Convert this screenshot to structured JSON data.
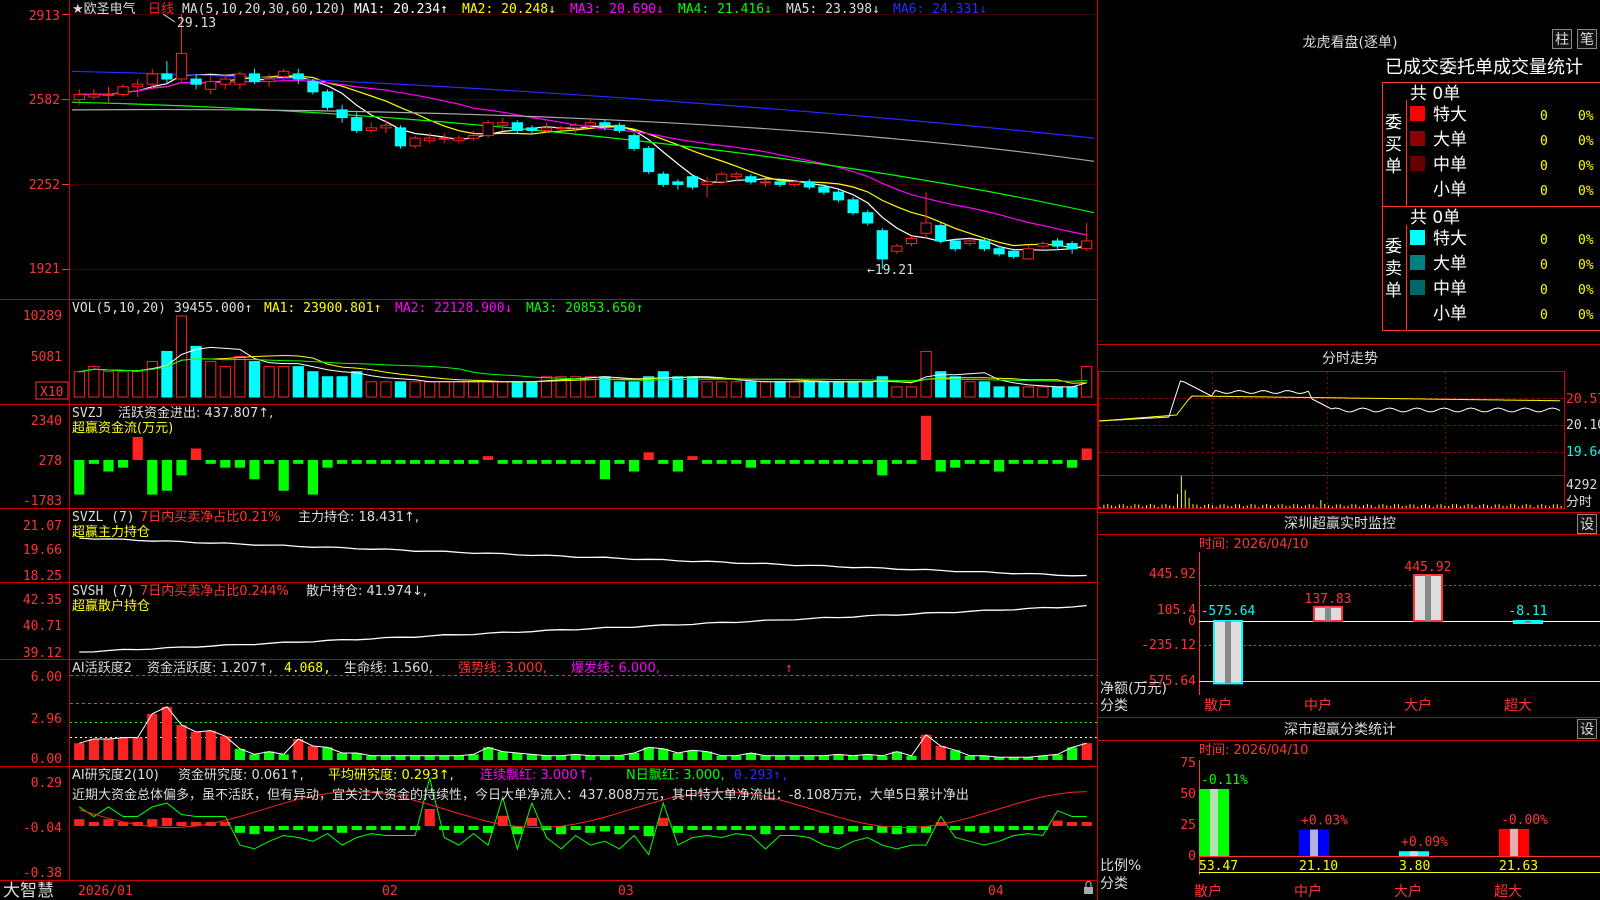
{
  "stock": {
    "name": "★欧圣电气",
    "period": "日线"
  },
  "colors": {
    "up": "#ff2222",
    "down": "#00ffff",
    "grid": "#8a0000",
    "white": "#ffffff",
    "yellow": "#ffff00",
    "magenta": "#ff00ff",
    "green": "#00ff00",
    "blue": "#2a2aff",
    "gray": "#aaaaaa",
    "axis": "#ff3333"
  },
  "price_panel": {
    "header": {
      "label": "MA(5,10,20,30,60,120)",
      "ma1": "MA1: 20.234↑",
      "ma2": "MA2: 20.248↓",
      "ma3": "MA3: 20.690↓",
      "ma4": "MA4: 21.416↓",
      "ma5": "MA5: 23.398↓",
      "ma6": "MA6: 24.331↓"
    },
    "y_ticks": [
      "2913",
      "2582",
      "2252",
      "1921"
    ],
    "high_label": "29.13",
    "low_label": "←19.21"
  },
  "vol_panel": {
    "header": {
      "label": "VOL(5,10,20)",
      "value": "39455.000↑",
      "ma1": "MA1: 23900.801↑",
      "ma2": "MA2: 22128.900↓",
      "ma3": "MA3: 20853.650↑"
    },
    "y_ticks": [
      "10289",
      "5081"
    ],
    "unit": "X10"
  },
  "svzj_panel": {
    "header": {
      "label": "SVZJ",
      "title": "活跃资金进出: 437.807↑,",
      "sub": "超赢资金流(万元)"
    },
    "y_ticks": [
      "2340",
      "278",
      "-1783"
    ]
  },
  "svzl_panel": {
    "header": {
      "label": "SVZL (7)",
      "pct": "7日内买卖净占比0.21%",
      "main": "主力持仓: 18.431↑,",
      "sub": "超赢主力持仓"
    },
    "y_ticks": [
      "21.07",
      "19.66",
      "18.25"
    ]
  },
  "svsh_panel": {
    "header": {
      "label": "SVSH (7)",
      "pct": "7日内买卖净占比0.244%",
      "main": "散户持仓: 41.974↓,",
      "sub": "超赢散户持仓"
    },
    "y_ticks": [
      "42.35",
      "40.71",
      "39.12"
    ]
  },
  "ai_active_panel": {
    "header": {
      "label": "AI活跃度2",
      "a": "资金活跃度: 1.207↑,",
      "b": "4.068,",
      "c": "生命线: 1.560,",
      "d": "强势线: 3.000,",
      "e": "爆发线: 6.000,",
      "f": "↑"
    },
    "y_ticks": [
      "6.00",
      "2.96",
      "0.00"
    ]
  },
  "ai_research_panel": {
    "header": {
      "label": "AI研究度2(10)",
      "a": "资金研究度: 0.061↑,",
      "b": "平均研究度: 0.293↑,",
      "c": "连续飘红: 3.000↑,",
      "d": "N日飘红: 3.000,",
      "e": "0.293↑,"
    },
    "comment": "近期大资金总体偏多，虽不活跃，但有异动，宜关注大资金的持续性，今日大单净流入：437.808万元，其中特大单净流出：-8.108万元，大单5日累计净出",
    "y_ticks": [
      "0.29",
      "-0.04",
      "-0.38"
    ]
  },
  "x_axis": {
    "labels": [
      "2026/01",
      "02",
      "03",
      "04"
    ]
  },
  "bottom_left": "大智慧",
  "lhb": {
    "title": "龙虎看盘(逐单)",
    "btn1": "柱",
    "btn2": "笔",
    "subtitle": "已成交委托单成交量统计",
    "buy": {
      "side": "委买单",
      "total": "共 0单",
      "rows": [
        {
          "label": "特大",
          "count": "0",
          "pct": "0%",
          "color": "#ff0000"
        },
        {
          "label": "大单",
          "count": "0",
          "pct": "0%",
          "color": "#8b0000"
        },
        {
          "label": "中单",
          "count": "0",
          "pct": "0%",
          "color": "#660000"
        },
        {
          "label": "小单",
          "count": "0",
          "pct": "0%",
          "color": ""
        }
      ]
    },
    "sell": {
      "side": "委卖单",
      "total": "共 0单",
      "rows": [
        {
          "label": "特大",
          "count": "0",
          "pct": "0%",
          "color": "#00ffff"
        },
        {
          "label": "大单",
          "count": "0",
          "pct": "0%",
          "color": "#008080"
        },
        {
          "label": "中单",
          "count": "0",
          "pct": "0%",
          "color": "#006666"
        },
        {
          "label": "小单",
          "count": "0",
          "pct": "0%",
          "color": ""
        }
      ]
    }
  },
  "intraday": {
    "title": "分时走势",
    "y_ticks": [
      "20.57",
      "20.10",
      "19.64"
    ],
    "vol_tick": "4292",
    "vol_unit": "分时"
  },
  "sz_monitor": {
    "title": "深圳超赢实时监控",
    "btn": "设",
    "time": "时间: 2026/04/10",
    "y_ticks": [
      "445.92",
      "105.4",
      "0",
      "-235.12",
      "-575.64"
    ],
    "y_label": "净额(万元)",
    "x_label": "分类",
    "categories": [
      "散户",
      "中户",
      "大户",
      "超大"
    ],
    "values": [
      -575.64,
      137.83,
      445.92,
      -8.11
    ],
    "value_labels": [
      "-575.64",
      "137.83",
      "445.92",
      "-8.11"
    ]
  },
  "sz_class": {
    "title": "深市超赢分类统计",
    "btn": "设",
    "time": "时间: 2026/04/10",
    "y_ticks": [
      "75",
      "50",
      "25",
      "0"
    ],
    "y_label": "比例%",
    "x_label": "分类",
    "categories": [
      "散户",
      "中户",
      "大户",
      "超大"
    ],
    "values": [
      53.47,
      21.1,
      3.8,
      21.63
    ],
    "value_labels": [
      "53.47",
      "21.10",
      "3.80",
      "21.63"
    ],
    "changes": [
      "-0.11%",
      "+0.03%",
      "+0.09%",
      "-0.00%"
    ],
    "bar_colors": [
      "#00ff00",
      "#0000ff",
      "#00ffff",
      "#ff0000"
    ]
  },
  "candles": [
    [
      25.8,
      26.0,
      25.6,
      26.2
    ],
    [
      25.9,
      26.0,
      25.8,
      26.2
    ],
    [
      26.0,
      26.0,
      25.7,
      26.3
    ],
    [
      26.0,
      26.3,
      25.9,
      26.4
    ],
    [
      26.3,
      26.4,
      25.9,
      26.6
    ],
    [
      26.4,
      26.8,
      26.2,
      27.0
    ],
    [
      26.8,
      26.6,
      26.4,
      27.3
    ],
    [
      26.6,
      27.6,
      26.5,
      29.13
    ],
    [
      26.6,
      26.4,
      26.2,
      26.8
    ],
    [
      26.2,
      26.5,
      26.0,
      26.7
    ],
    [
      26.4,
      26.6,
      26.2,
      26.8
    ],
    [
      26.4,
      26.8,
      26.2,
      26.9
    ],
    [
      26.8,
      26.5,
      26.4,
      27.0
    ],
    [
      26.5,
      26.6,
      26.3,
      26.8
    ],
    [
      26.7,
      26.9,
      26.5,
      27.0
    ],
    [
      26.8,
      26.6,
      26.4,
      27.0
    ],
    [
      26.5,
      26.1,
      26.0,
      26.6
    ],
    [
      26.1,
      25.5,
      25.4,
      26.2
    ],
    [
      25.4,
      25.1,
      24.9,
      25.6
    ],
    [
      25.1,
      24.6,
      24.5,
      25.3
    ],
    [
      24.6,
      24.7,
      24.5,
      24.9
    ],
    [
      24.7,
      24.8,
      24.5,
      25.0
    ],
    [
      24.7,
      24.0,
      23.9,
      24.8
    ],
    [
      24.0,
      24.3,
      23.9,
      24.4
    ],
    [
      24.2,
      24.3,
      24.1,
      24.5
    ],
    [
      24.3,
      24.3,
      24.1,
      24.5
    ],
    [
      24.2,
      24.3,
      24.1,
      24.4
    ],
    [
      24.3,
      24.4,
      24.2,
      24.6
    ],
    [
      24.4,
      24.9,
      24.3,
      25.0
    ],
    [
      24.8,
      24.9,
      24.6,
      25.1
    ],
    [
      24.9,
      24.6,
      24.5,
      25.0
    ],
    [
      24.7,
      24.6,
      24.5,
      24.8
    ],
    [
      24.6,
      24.7,
      24.5,
      24.9
    ],
    [
      24.7,
      24.7,
      24.6,
      24.8
    ],
    [
      24.7,
      24.8,
      24.5,
      24.9
    ],
    [
      24.8,
      24.9,
      24.7,
      25.0
    ],
    [
      24.9,
      24.8,
      24.6,
      25.0
    ],
    [
      24.8,
      24.6,
      24.5,
      24.9
    ],
    [
      24.4,
      23.9,
      23.8,
      24.5
    ],
    [
      23.9,
      23.0,
      22.9,
      24.0
    ],
    [
      22.9,
      22.5,
      22.4,
      23.0
    ],
    [
      22.6,
      22.5,
      22.3,
      22.7
    ],
    [
      22.8,
      22.4,
      22.3,
      22.9
    ],
    [
      22.5,
      22.6,
      22.0,
      22.8
    ],
    [
      22.6,
      22.9,
      22.5,
      23.0
    ],
    [
      22.8,
      22.9,
      22.6,
      23.0
    ],
    [
      22.8,
      22.6,
      22.5,
      22.9
    ],
    [
      22.6,
      22.6,
      22.4,
      22.7
    ],
    [
      22.6,
      22.5,
      22.4,
      22.7
    ],
    [
      22.5,
      22.6,
      22.4,
      22.7
    ],
    [
      22.6,
      22.4,
      22.3,
      22.7
    ],
    [
      22.4,
      22.2,
      22.1,
      22.5
    ],
    [
      22.2,
      21.9,
      21.8,
      22.3
    ],
    [
      21.9,
      21.4,
      21.3,
      22.0
    ],
    [
      21.4,
      21.0,
      20.9,
      21.5
    ],
    [
      20.7,
      19.6,
      19.21,
      20.8
    ],
    [
      19.9,
      20.1,
      19.8,
      20.2
    ],
    [
      20.2,
      20.4,
      20.1,
      20.5
    ],
    [
      20.6,
      21.0,
      20.4,
      22.2
    ],
    [
      20.9,
      20.3,
      20.2,
      21.0
    ],
    [
      20.3,
      20.0,
      19.9,
      20.4
    ],
    [
      20.2,
      20.3,
      20.1,
      20.4
    ],
    [
      20.3,
      20.0,
      19.9,
      20.4
    ],
    [
      20.0,
      19.8,
      19.7,
      20.1
    ],
    [
      19.9,
      19.7,
      19.6,
      20.0
    ],
    [
      19.6,
      20.0,
      19.6,
      20.1
    ],
    [
      20.1,
      20.2,
      20.0,
      20.3
    ],
    [
      20.3,
      20.1,
      20.0,
      20.4
    ],
    [
      20.2,
      20.0,
      19.8,
      20.3
    ],
    [
      20.0,
      20.3,
      19.9,
      21.0
    ]
  ],
  "volumes": [
    5,
    6,
    5,
    5,
    5,
    7,
    9,
    16,
    10,
    7,
    6,
    8,
    7,
    6,
    6,
    6,
    5,
    4,
    4,
    5,
    3,
    3,
    3,
    3,
    3,
    3,
    3,
    3,
    3,
    3,
    3,
    3,
    4,
    4,
    4,
    4,
    4,
    3,
    3,
    4,
    5,
    4,
    4,
    3,
    3,
    3,
    3,
    3,
    3,
    3,
    3,
    3,
    3,
    3,
    3,
    4,
    2,
    2,
    9,
    5,
    4,
    3,
    3,
    2,
    2,
    2,
    2,
    2,
    2,
    6
  ],
  "svzj_values": [
    -1800,
    -200,
    -600,
    -400,
    1200,
    -1800,
    -1600,
    -800,
    600,
    -200,
    -400,
    -400,
    -1000,
    -200,
    -1600,
    -200,
    -1800,
    -400,
    -200,
    -200,
    -200,
    -200,
    -200,
    -200,
    -200,
    -200,
    -200,
    -200,
    200,
    -200,
    -200,
    -200,
    -200,
    -200,
    -200,
    -200,
    -1000,
    -200,
    -600,
    400,
    -200,
    -600,
    200,
    -200,
    -200,
    -200,
    -400,
    -200,
    -200,
    -200,
    -200,
    -200,
    -200,
    -200,
    -200,
    -800,
    -200,
    -200,
    2300,
    -600,
    -400,
    -200,
    -200,
    -600,
    -200,
    -200,
    -200,
    -200,
    -400,
    600
  ],
  "ai_active_values": [
    1.2,
    1.5,
    1.5,
    1.6,
    1.6,
    3.3,
    3.8,
    2.5,
    2.0,
    2.1,
    1.7,
    0.8,
    0.4,
    0.6,
    0.4,
    1.5,
    1.0,
    0.9,
    0.5,
    0.5,
    0.3,
    0.3,
    0.3,
    0.3,
    0.3,
    0.3,
    0.3,
    0.4,
    0.9,
    0.6,
    0.5,
    0.4,
    0.3,
    0.3,
    0.4,
    0.3,
    0.3,
    0.3,
    0.5,
    0.9,
    0.8,
    0.5,
    0.7,
    0.6,
    0.3,
    0.3,
    0.5,
    0.3,
    0.3,
    0.3,
    0.3,
    0.3,
    0.4,
    0.3,
    0.4,
    0.3,
    0.6,
    0.3,
    1.8,
    1.0,
    0.7,
    0.3,
    0.3,
    0.2,
    0.2,
    0.2,
    0.3,
    0.4,
    0.9,
    1.2
  ],
  "ai_research_values": [
    0.1,
    0.05,
    0.1,
    0.05,
    0.05,
    0.1,
    0.12,
    0.06,
    0.05,
    0.05,
    0.05,
    -0.1,
    -0.12,
    -0.08,
    -0.05,
    -0.06,
    -0.08,
    -0.04,
    -0.1,
    -0.06,
    -0.04,
    -0.05,
    -0.05,
    -0.05,
    0.25,
    -0.06,
    -0.1,
    -0.04,
    -0.1,
    0.15,
    -0.12,
    0.12,
    -0.06,
    -0.12,
    -0.05,
    -0.1,
    -0.08,
    -0.12,
    -0.05,
    -0.15,
    0.12,
    -0.1,
    -0.06,
    -0.05,
    -0.06,
    -0.04,
    -0.05,
    -0.12,
    -0.05,
    -0.05,
    -0.06,
    -0.1,
    -0.12,
    -0.08,
    -0.06,
    -0.1,
    -0.12,
    -0.1,
    -0.1,
    0.05,
    -0.06,
    -0.08,
    -0.1,
    -0.08,
    -0.05,
    -0.04,
    -0.05,
    0.08,
    0.05,
    0.05
  ]
}
